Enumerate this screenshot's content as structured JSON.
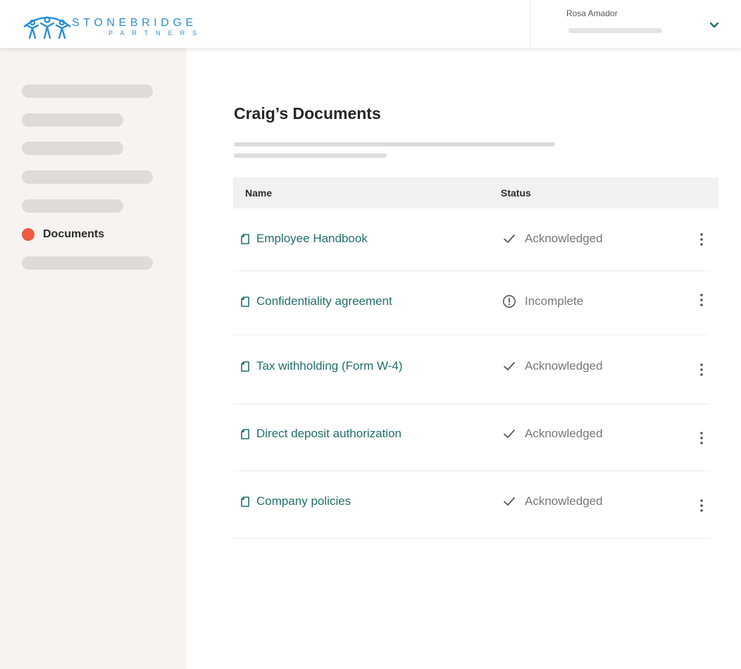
{
  "brand": {
    "name": "STONEBRIDGE",
    "tagline": "PARTNERS",
    "color": "#2a8fd6",
    "logo_icon": "people-arch-logo-icon"
  },
  "user": {
    "name": "Rosa Amador",
    "menu_icon": "chevron-down-icon"
  },
  "sidebar": {
    "active_item": {
      "label": "Documents",
      "indicator_color": "#ee5a44"
    }
  },
  "page": {
    "title": "Craig’s Documents"
  },
  "table": {
    "columns": [
      "Name",
      "Status"
    ],
    "rows": [
      {
        "name": "Employee Handbook",
        "status": "Acknowledged",
        "status_icon": "check-icon"
      },
      {
        "name": "Confidentiality agreement",
        "status": "Incomplete",
        "status_icon": "alert-circle-icon"
      },
      {
        "name": "Tax withholding (Form W-4)",
        "status": "Acknowledged",
        "status_icon": "check-icon"
      },
      {
        "name": "Direct deposit authorization",
        "status": "Acknowledged",
        "status_icon": "check-icon"
      },
      {
        "name": "Company policies",
        "status": "Acknowledged",
        "status_icon": "check-icon"
      }
    ]
  },
  "colors": {
    "link": "#1f6f6b",
    "accent": "#ee5a44",
    "status_text": "#777777"
  }
}
